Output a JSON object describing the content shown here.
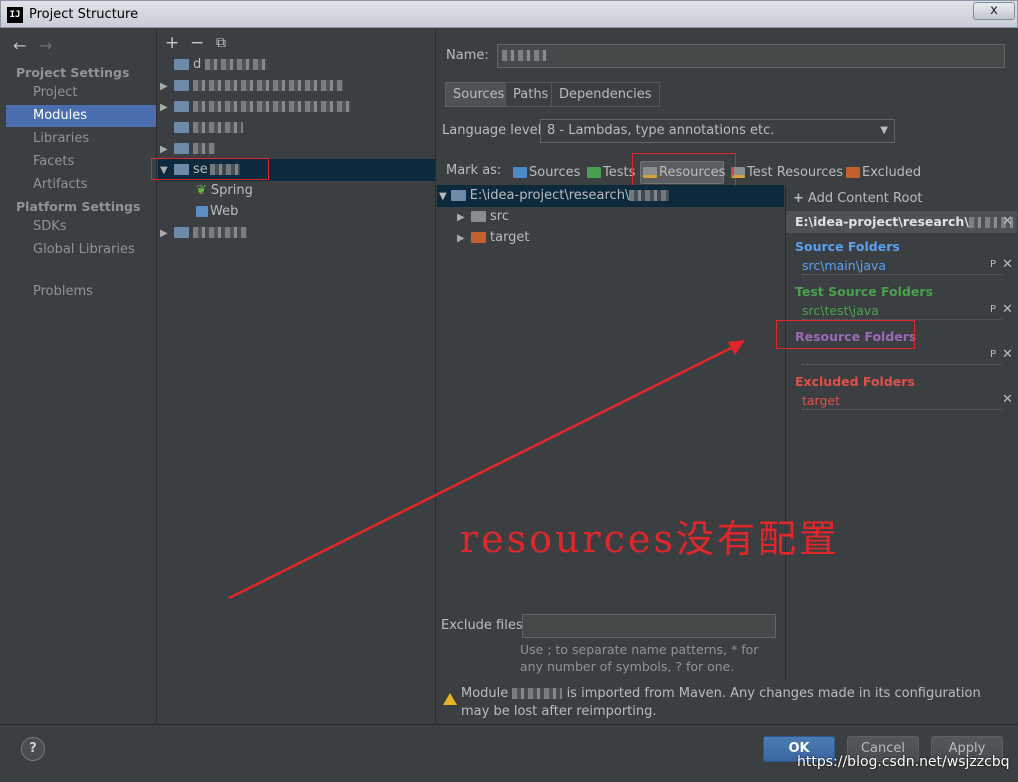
{
  "window": {
    "title": "Project Structure",
    "logo": "IJ",
    "close_label": "x"
  },
  "sidebar": {
    "back_icon": "←",
    "forward_icon": "→",
    "sections": [
      {
        "label": "Project Settings",
        "items": [
          "Project",
          "Modules",
          "Libraries",
          "Facets",
          "Artifacts"
        ]
      },
      {
        "label": "Platform Settings",
        "items": [
          "SDKs",
          "Global Libraries"
        ]
      }
    ],
    "problems": "Problems",
    "selected": "Modules"
  },
  "tree": {
    "toolbar": {
      "add": "+",
      "remove": "−",
      "copy": "⧉"
    },
    "rows": [
      {
        "name": "d"
      },
      {
        "name": ""
      },
      {
        "name": ""
      },
      {
        "name": ""
      },
      {
        "name": ""
      },
      {
        "name": "se"
      },
      {
        "name": "Spring"
      },
      {
        "name": "Web"
      },
      {
        "name": ""
      }
    ]
  },
  "main": {
    "name_label": "Name:",
    "tabs": [
      "Sources",
      "Paths",
      "Dependencies"
    ],
    "language_label": "Language level:",
    "language_value": "8 - Lambdas, type annotations etc.",
    "mark_as_label": "Mark as:",
    "mark_buttons": [
      "Sources",
      "Tests",
      "Resources",
      "Test Resources",
      "Excluded"
    ],
    "root_path": "E:\\idea-project\\research\\",
    "children": [
      "src",
      "target"
    ],
    "exclude_label": "Exclude files:",
    "exclude_hint": "Use ; to separate name patterns, * for any number of symbols, ? for one.",
    "warning_prefix": "Module",
    "warning_text": "is imported from Maven. Any changes made in its configuration may be lost after reimporting."
  },
  "content_root": {
    "add_label": "Add Content Root",
    "path": "E:\\idea-project\\research\\",
    "source_title": "Source Folders",
    "source_path": "src\\main\\java",
    "test_title": "Test Source Folders",
    "test_path": "src\\test\\java",
    "resource_title": "Resource Folders",
    "resource_path": "",
    "excluded_title": "Excluded Folders",
    "excluded_path": "target",
    "properties_icon": "P",
    "remove_icon": "✕"
  },
  "footer": {
    "help": "?",
    "ok": "OK",
    "cancel": "Cancel",
    "apply": "Apply"
  },
  "annotation": {
    "text": "resources没有配置"
  },
  "watermark": "https://blog.csdn.net/wsjzzcbq",
  "colors": {
    "selection": "#4b6eaf",
    "source": "#5aa0f0",
    "test": "#49a04e",
    "resource": "#9a6ab8",
    "excluded": "#e0504a",
    "annotation": "#e0262a"
  }
}
